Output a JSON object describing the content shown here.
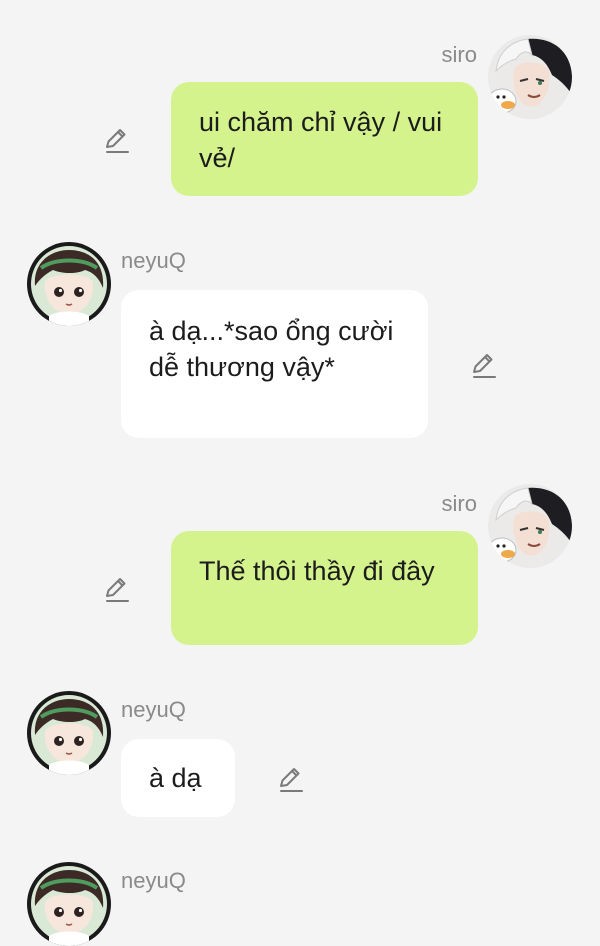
{
  "messages": [
    {
      "sender": "siro",
      "side": "right",
      "text": "ui chăm chỉ vậy / vui vẻ/"
    },
    {
      "sender": "neyuQ",
      "side": "left",
      "text": "à dạ...*sao ổng cười dễ thương vậy*"
    },
    {
      "sender": "siro",
      "side": "right",
      "text": "Thế thôi thầy đi đây"
    },
    {
      "sender": "neyuQ",
      "side": "left",
      "text": "à dạ"
    },
    {
      "sender": "neyuQ",
      "side": "left",
      "text": ""
    }
  ],
  "icons": {
    "edit": "edit-pencil-icon",
    "avatar_siro": "avatar-siro",
    "avatar_neyuq": "avatar-neyuq"
  },
  "colors": {
    "background": "#f4f4f4",
    "sent_bubble": "#d4f38d",
    "received_bubble": "#ffffff",
    "name_text": "#8a8a8a",
    "message_text": "#1c1c1c"
  }
}
